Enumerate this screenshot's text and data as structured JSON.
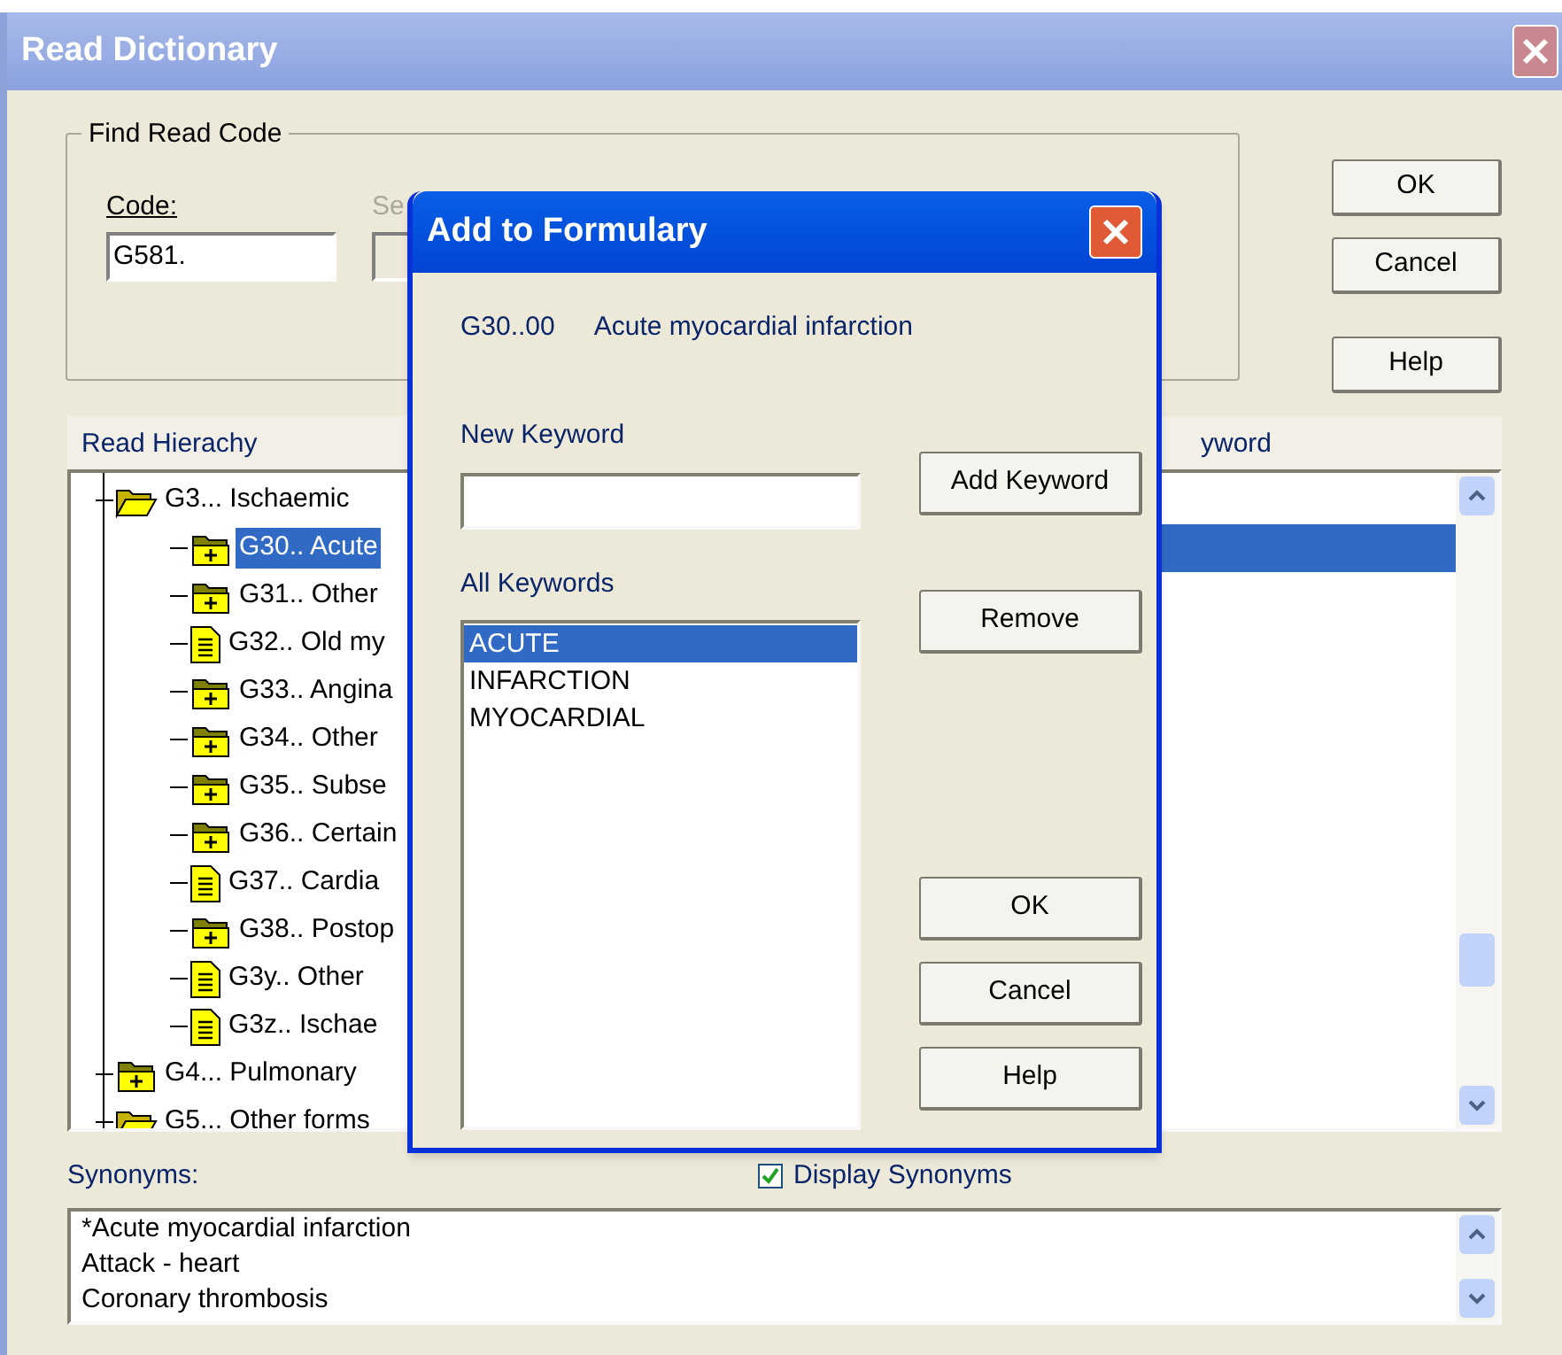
{
  "window": {
    "title": "Read Dictionary"
  },
  "find_group": {
    "title": "Find Read Code",
    "code_label": "Code:",
    "code_value": "G581.",
    "second_label": "Se",
    "second_disabled": true
  },
  "buttons": [
    {
      "label": "OK"
    },
    {
      "label": "Cancel"
    },
    {
      "label": "Help"
    }
  ],
  "hierarchy": {
    "header": "Read Hierachy",
    "items": [
      {
        "label": "G3... Ischaemic",
        "kind": "folder_open",
        "selected": false,
        "children": [
          {
            "label": "G30.. Acute",
            "kind": "folder",
            "selected": true
          },
          {
            "label": "G31.. Other",
            "kind": "folder",
            "selected": false
          },
          {
            "label": "G32.. Old my",
            "kind": "document",
            "selected": false
          },
          {
            "label": "G33.. Angina",
            "kind": "folder",
            "selected": false
          },
          {
            "label": "G34.. Other",
            "kind": "folder",
            "selected": false
          },
          {
            "label": "G35.. Subse",
            "kind": "folder",
            "selected": false
          },
          {
            "label": "G36.. Certain",
            "kind": "folder",
            "selected": false
          },
          {
            "label": "G37.. Cardia",
            "kind": "document",
            "selected": false
          },
          {
            "label": "G38.. Postop",
            "kind": "folder",
            "selected": false
          },
          {
            "label": "G3y.. Other",
            "kind": "document",
            "selected": false
          },
          {
            "label": "G3z.. Ischae",
            "kind": "document",
            "selected": false
          }
        ]
      },
      {
        "label": "G4... Pulmonary",
        "kind": "folder",
        "selected": false
      },
      {
        "label": "G5... Other forms",
        "kind": "folder_open",
        "selected": false
      }
    ]
  },
  "keyword_panel": {
    "header": "yword"
  },
  "synonyms": {
    "label": "Synonyms:",
    "display_label": "Display Synonyms",
    "display_checked": true,
    "items": [
      "*Acute myocardial infarction",
      "Attack - heart",
      "Coronary thrombosis"
    ]
  },
  "dialog": {
    "title": "Add to Formulary",
    "code": "G30..00",
    "description": "Acute myocardial infarction",
    "new_keyword_label": "New Keyword",
    "all_keywords_label": "All Keywords",
    "keywords": [
      {
        "label": "ACUTE",
        "selected": true
      },
      {
        "label": "INFARCTION",
        "selected": false
      },
      {
        "label": "MYOCARDIAL",
        "selected": false
      }
    ],
    "add_button": "Add Keyword",
    "remove_button": "Remove",
    "buttons": [
      {
        "label": "OK"
      },
      {
        "label": "Cancel"
      },
      {
        "label": "Help"
      }
    ]
  }
}
